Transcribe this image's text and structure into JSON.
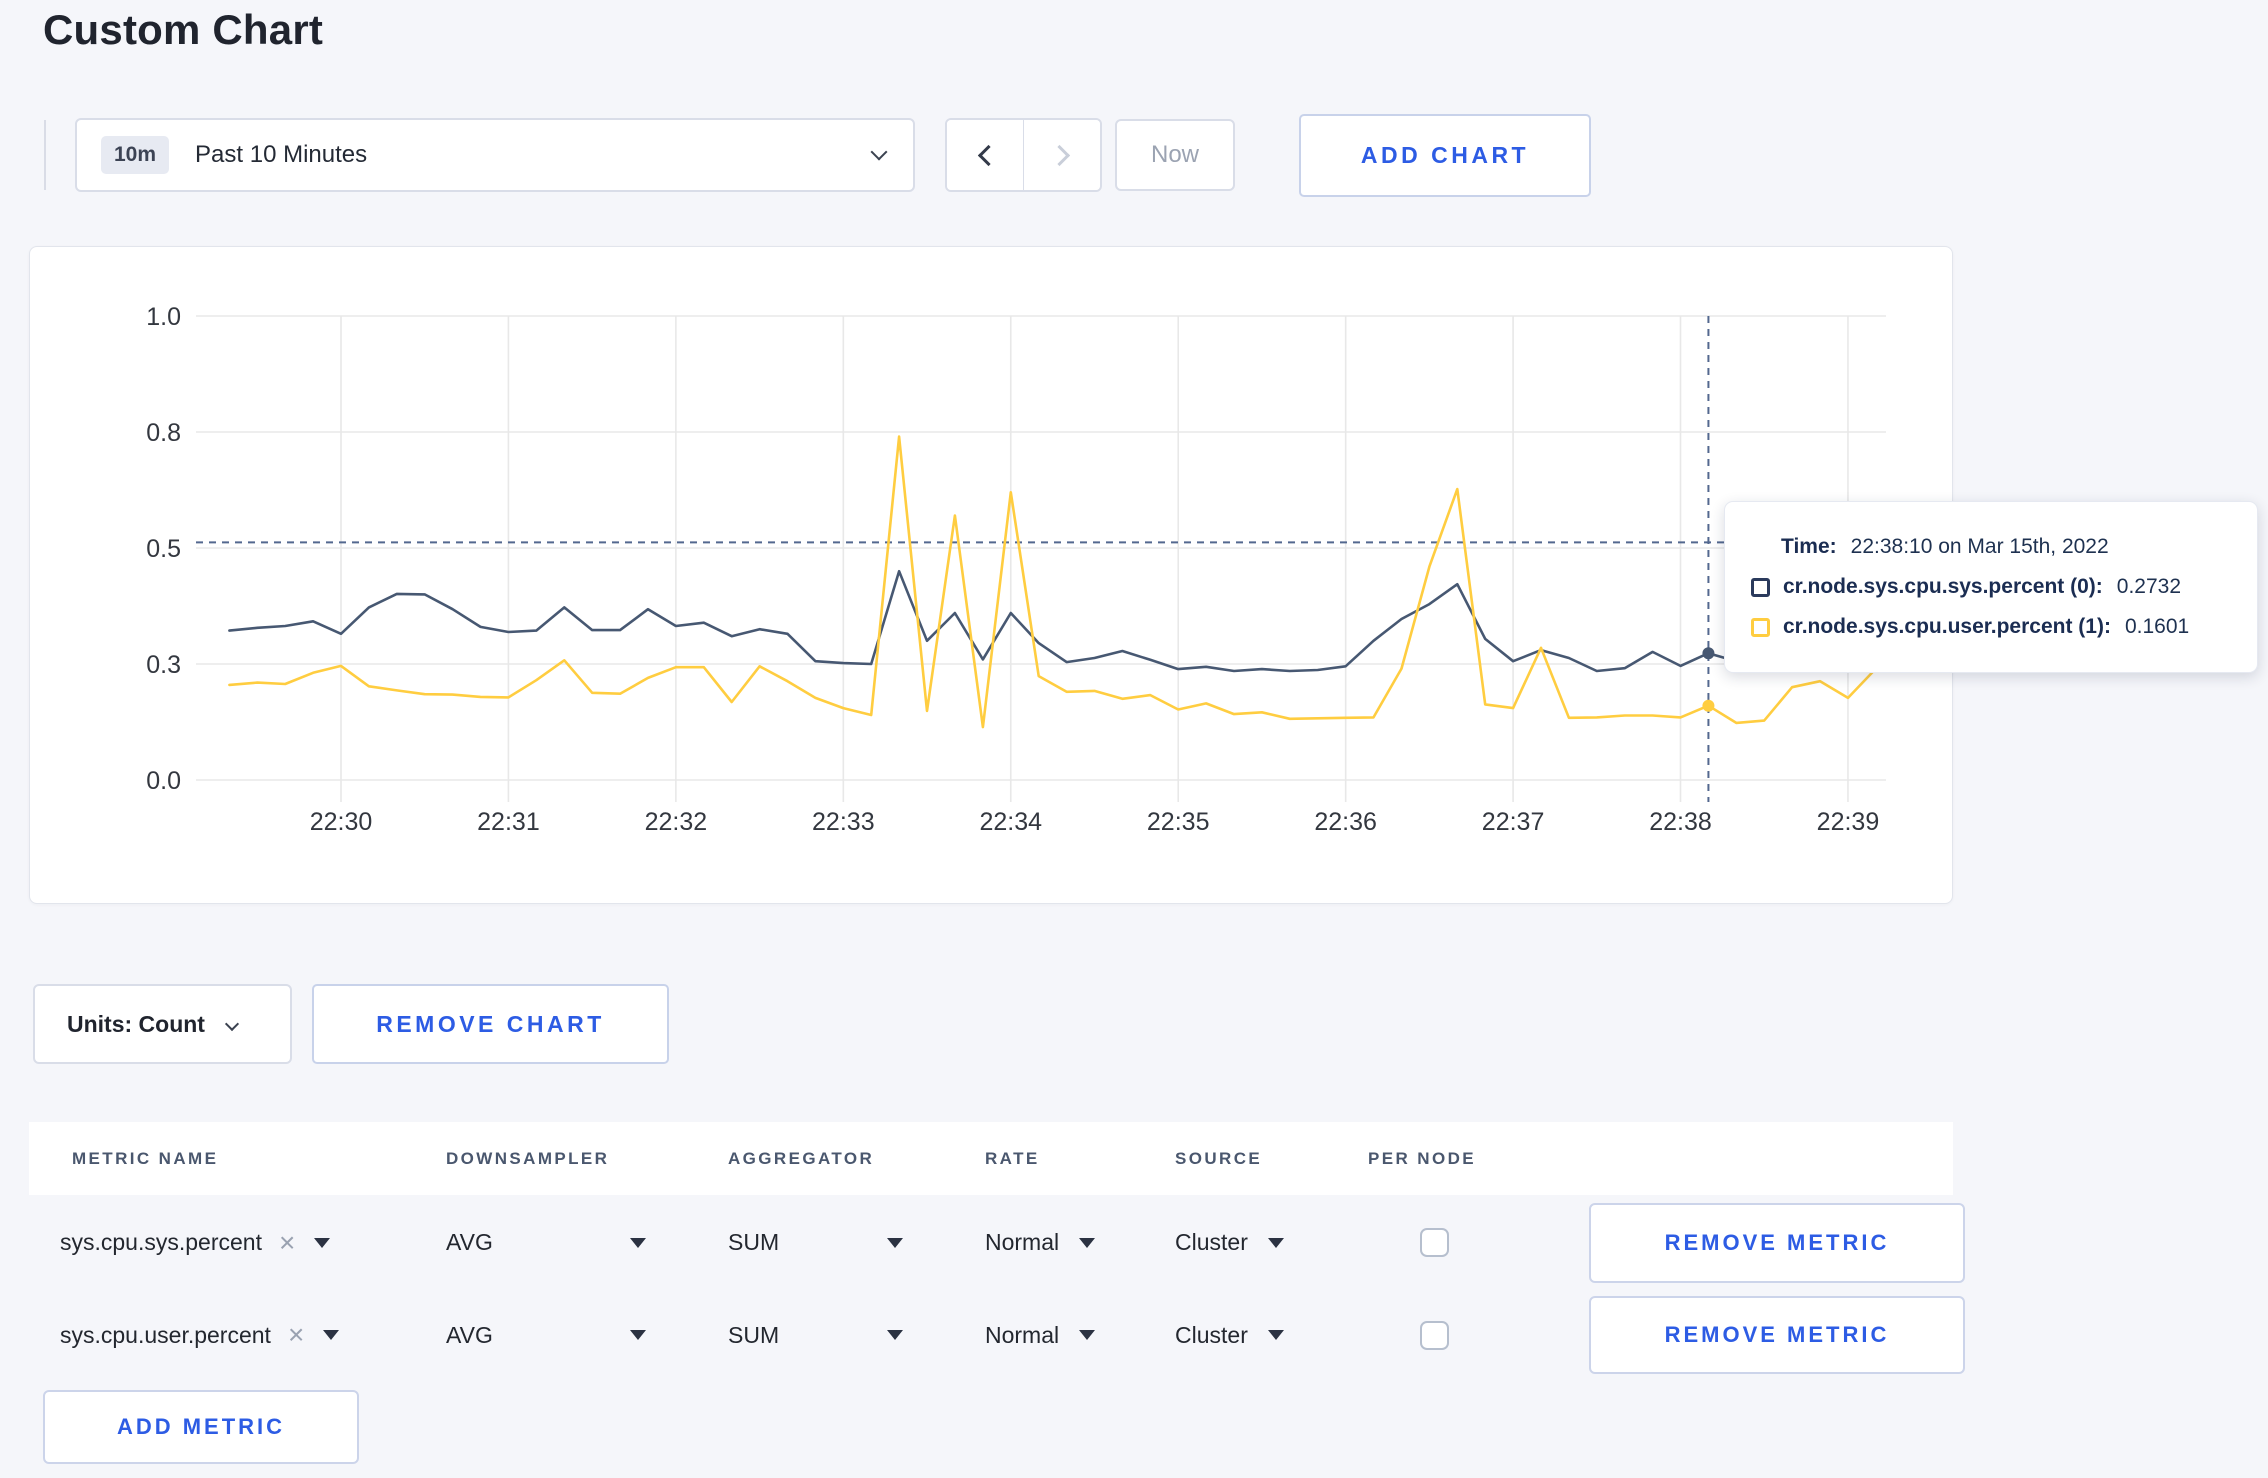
{
  "page": {
    "title": "Custom Chart"
  },
  "toolbar": {
    "time_window_badge": "10m",
    "time_window_label": "Past 10 Minutes",
    "now_label": "Now",
    "add_chart_label": "ADD CHART"
  },
  "chart_data": {
    "type": "line",
    "title": "",
    "xlabel": "",
    "ylabel": "",
    "ylim": [
      0,
      1
    ],
    "grid": true,
    "legend_position": "tooltip",
    "y_gridline_values": [
      0,
      0.25,
      0.5,
      0.75,
      1
    ],
    "y_tick_labels": [
      "0.0",
      "0.3",
      "0.5",
      "0.8",
      "1.0"
    ],
    "x_ticks": [
      {
        "label": "22:30",
        "seconds": 0
      },
      {
        "label": "22:31",
        "seconds": 60
      },
      {
        "label": "22:32",
        "seconds": 120
      },
      {
        "label": "22:33",
        "seconds": 180
      },
      {
        "label": "22:34",
        "seconds": 240
      },
      {
        "label": "22:35",
        "seconds": 300
      },
      {
        "label": "22:36",
        "seconds": 360
      },
      {
        "label": "22:37",
        "seconds": 420
      },
      {
        "label": "22:38",
        "seconds": 480
      },
      {
        "label": "22:39",
        "seconds": 540
      }
    ],
    "x_start_seconds": -40,
    "x_step_seconds": 10,
    "series": [
      {
        "name": "cr.node.sys.cpu.sys.percent",
        "color": "#475872",
        "values": [
          0.322,
          0.328,
          0.332,
          0.342,
          0.315,
          0.372,
          0.401,
          0.4,
          0.368,
          0.33,
          0.319,
          0.322,
          0.372,
          0.323,
          0.323,
          0.368,
          0.332,
          0.339,
          0.31,
          0.325,
          0.315,
          0.256,
          0.252,
          0.25,
          0.45,
          0.3,
          0.36,
          0.26,
          0.36,
          0.295,
          0.254,
          0.263,
          0.278,
          0.259,
          0.239,
          0.244,
          0.235,
          0.239,
          0.235,
          0.237,
          0.245,
          0.3,
          0.347,
          0.379,
          0.422,
          0.304,
          0.256,
          0.28,
          0.263,
          0.235,
          0.241,
          0.276,
          0.246,
          0.2732,
          0.256,
          0.262,
          0.268,
          0.258,
          0.263,
          0.268
        ]
      },
      {
        "name": "cr.node.sys.cpu.user.percent",
        "color": "#ffcd40",
        "values": [
          0.205,
          0.21,
          0.207,
          0.231,
          0.246,
          0.202,
          0.193,
          0.185,
          0.184,
          0.179,
          0.178,
          0.215,
          0.258,
          0.188,
          0.186,
          0.22,
          0.243,
          0.243,
          0.168,
          0.245,
          0.213,
          0.177,
          0.155,
          0.14,
          0.74,
          0.149,
          0.57,
          0.114,
          0.62,
          0.224,
          0.19,
          0.192,
          0.175,
          0.183,
          0.152,
          0.165,
          0.142,
          0.146,
          0.132,
          0.133,
          0.134,
          0.135,
          0.24,
          0.46,
          0.627,
          0.163,
          0.155,
          0.285,
          0.134,
          0.135,
          0.139,
          0.139,
          0.135,
          0.1601,
          0.123,
          0.128,
          0.2,
          0.213,
          0.177,
          0.24
        ]
      }
    ],
    "crosshair": {
      "x_seconds": 490,
      "y_value": 0.512,
      "dot_values": [
        0.2732,
        0.1601
      ]
    }
  },
  "tooltip": {
    "time_label": "Time:",
    "time_value": "22:38:10 on Mar 15th, 2022",
    "series": [
      {
        "name": "cr.node.sys.cpu.sys.percent (0):",
        "value": "0.2732",
        "color": "#2a3a5c"
      },
      {
        "name": "cr.node.sys.cpu.user.percent (1):",
        "value": "0.1601",
        "color": "#ffcd40"
      }
    ]
  },
  "chart_footer": {
    "units_label": "Units: Count",
    "remove_chart_label": "REMOVE CHART"
  },
  "metrics_table": {
    "columns": [
      "METRIC NAME",
      "DOWNSAMPLER",
      "AGGREGATOR",
      "RATE",
      "SOURCE",
      "PER NODE"
    ],
    "rows": [
      {
        "metric_name": "sys.cpu.sys.percent",
        "downsampler": "AVG",
        "aggregator": "SUM",
        "rate": "Normal",
        "source": "Cluster",
        "per_node": false,
        "remove_label": "REMOVE METRIC"
      },
      {
        "metric_name": "sys.cpu.user.percent",
        "downsampler": "AVG",
        "aggregator": "SUM",
        "rate": "Normal",
        "source": "Cluster",
        "per_node": false,
        "remove_label": "REMOVE METRIC"
      }
    ],
    "add_metric_label": "ADD METRIC"
  },
  "colors": {
    "accent_blue": "#2d5ce4",
    "series_sys": "#475872",
    "series_user": "#ffcd40",
    "crosshair": "#53688f",
    "gridline": "#e8e8e8"
  }
}
